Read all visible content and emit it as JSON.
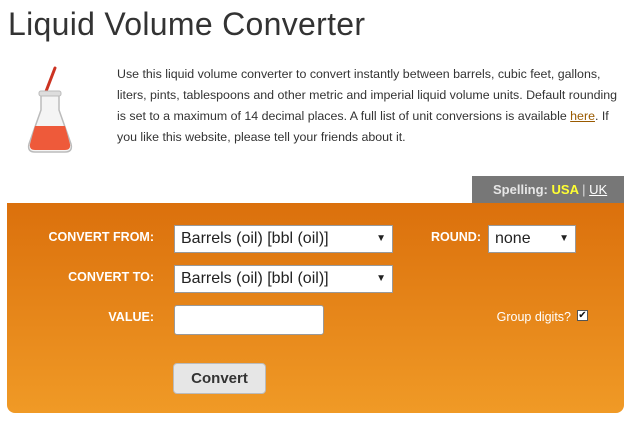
{
  "title": "Liquid Volume Converter",
  "intro": {
    "text_before": "Use this liquid volume converter to convert instantly between barrels, cubic feet, gallons, liters, pints, tablespoons and other metric and imperial liquid volume units. Default rounding is set to a maximum of 14 decimal places. A full list of unit conversions is available ",
    "link": "here",
    "text_after": ". If you like this website, please tell your friends about it.",
    "icon": "flask-icon"
  },
  "spelling": {
    "label": "Spelling:",
    "usa": "USA",
    "separator": "|",
    "uk": "UK"
  },
  "form": {
    "convert_from_label": "CONVERT FROM:",
    "convert_from_value": "Barrels (oil) [bbl (oil)]",
    "convert_to_label": "CONVERT TO:",
    "convert_to_value": "Barrels (oil) [bbl (oil)]",
    "round_label": "ROUND:",
    "round_value": "none",
    "value_label": "VALUE:",
    "value": "",
    "group_digits_label": "Group digits?",
    "group_digits_checked": true,
    "check_mark": "✔",
    "dropdown_arrow": "▼",
    "convert_button": "Convert"
  },
  "colors": {
    "panel_top": "#db700c",
    "panel_bottom": "#f09a26",
    "spelling_bar": "#777777",
    "usa_highlight": "#ffff33"
  }
}
